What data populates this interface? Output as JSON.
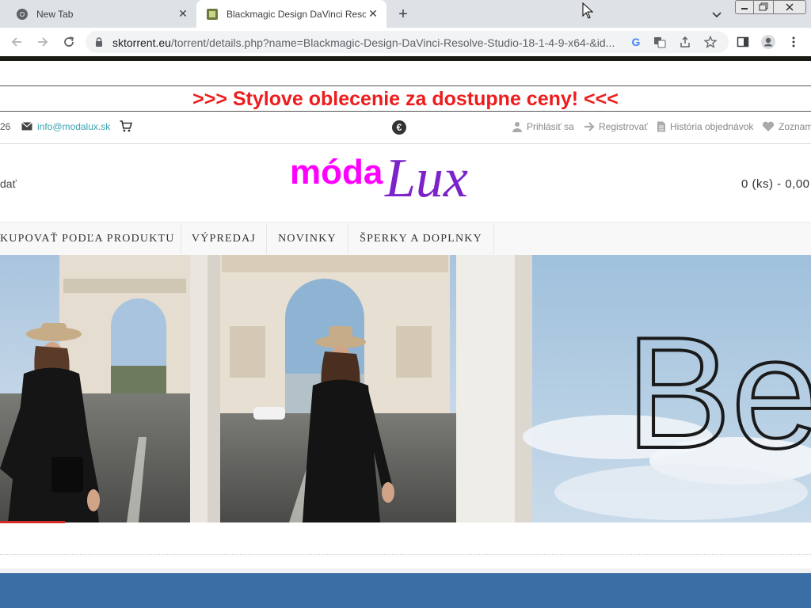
{
  "browser": {
    "tabs": [
      {
        "title": "New Tab",
        "icon": "chrome-icon"
      },
      {
        "title": "Blackmagic Design DaVinci Resolv",
        "icon": "site-favicon"
      }
    ],
    "new_tab_label": "+",
    "url_host": "sktorrent.eu",
    "url_path": "/torrent/details.php?name=Blackmagic-Design-DaVinci-Resolve-Studio-18-1-4-9-x64-&id..."
  },
  "page": {
    "promo": ">>> Stylove oblecenie za dostupne ceny! <<<",
    "topbar": {
      "phone_fragment": "26",
      "email": "info@modalux.sk",
      "currency": "€",
      "links": {
        "login": "Prihlásiť sa",
        "register": "Registrovať",
        "orders": "História objednávok",
        "wishlist": "Zoznam"
      }
    },
    "left_fragment": "dať",
    "logo": {
      "part1": "móda",
      "part2": "Lux"
    },
    "cart_total": "0 (ks) - 0,00",
    "nav": [
      "KUPOVAŤ PODĽA PRODUKTU",
      "VÝPREDAJ",
      "NOVINKY",
      "ŠPERKY A DOPLNKY"
    ],
    "hero_text": "Be"
  },
  "colors": {
    "promo": "#ee1c1c",
    "logo_moda": "#ff00ff",
    "logo_lux": "#7b22c9",
    "email": "#3aa3b3",
    "footer": "#3b6ea5"
  }
}
